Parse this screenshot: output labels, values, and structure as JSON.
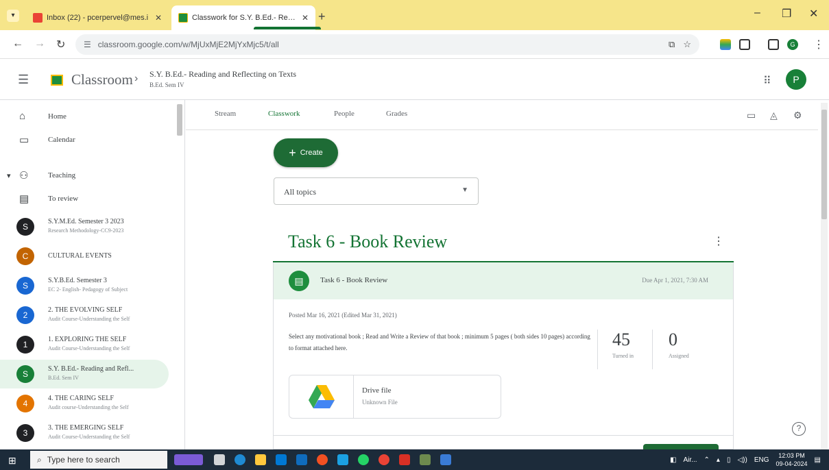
{
  "browser": {
    "tabs": [
      {
        "title": "Inbox (22) - pcerpervel@mes.i",
        "active": false
      },
      {
        "title": "Classwork for S.Y. B.Ed.- Readi",
        "active": true
      }
    ],
    "url": "classroom.google.com/w/MjUxMjE2MjYxMjc5/t/all",
    "profile_initial": "G"
  },
  "header": {
    "brand": "Classroom",
    "course_title": "S.Y. B.Ed.- Reading and Reflecting on Texts",
    "course_section": "B.Ed. Sem IV",
    "avatar_initial": "P"
  },
  "sidebar": {
    "nav": [
      {
        "label": "Home",
        "icon": "home-icon"
      },
      {
        "label": "Calendar",
        "icon": "calendar-icon"
      },
      {
        "label": "Teaching",
        "icon": "people-icon"
      },
      {
        "label": "To review",
        "icon": "folder-icon"
      }
    ],
    "classes": [
      {
        "initial": "S",
        "name": "S.Y.M.Ed. Semester 3 2023",
        "sub": "Research Methodology-CC9-2023",
        "color": "#202124",
        "active": false
      },
      {
        "initial": "C",
        "name": "CULTURAL EVENTS",
        "sub": "",
        "color": "#c26401",
        "active": false
      },
      {
        "initial": "S",
        "name": "S.Y.B.Ed. Semester 3",
        "sub": "EC 2- English- Pedagogy of Subject",
        "color": "#1967d2",
        "active": false
      },
      {
        "initial": "2",
        "name": "2. THE EVOLVING SELF",
        "sub": "Audit Course-Understanding the Self",
        "color": "#1967d2",
        "active": false
      },
      {
        "initial": "1",
        "name": "1. EXPLORING THE SELF",
        "sub": "Audit Course-Understanding the Self",
        "color": "#202124",
        "active": false
      },
      {
        "initial": "S",
        "name": "S.Y. B.Ed.- Reading and Refl...",
        "sub": "B.Ed. Sem IV",
        "color": "#188038",
        "active": true
      },
      {
        "initial": "4",
        "name": "4. THE CARING SELF",
        "sub": "Audit course-Understanding the Self",
        "color": "#e37400",
        "active": false
      },
      {
        "initial": "3",
        "name": "3. THE EMERGING SELF",
        "sub": "Audit Course-Understanding the Self",
        "color": "#202124",
        "active": false
      }
    ]
  },
  "main": {
    "tabs": [
      "Stream",
      "Classwork",
      "People",
      "Grades"
    ],
    "active_tab": "Classwork",
    "create_label": "Create",
    "topic_filter": "All topics",
    "topic": {
      "title": "Task 6 - Book Review",
      "assignment": {
        "title": "Task 6 - Book Review",
        "due": "Due Apr 1, 2021, 7:30 AM",
        "posted": "Posted Mar 16, 2021 (Edited Mar 31, 2021)",
        "description": "Select any motivational book ; Read and Write a Review of that book ; minimum 5 pages ( both sides 10 pages) according to format attached here.",
        "turned_in": "45",
        "turned_in_label": "Turned in",
        "assigned": "0",
        "assigned_label": "Assigned",
        "attachment": {
          "name": "Drive file",
          "type": "Unknown File"
        }
      }
    }
  },
  "taskbar": {
    "search_placeholder": "Type here to search",
    "tray_label": "Air...",
    "lang": "ENG",
    "time": "12:03 PM",
    "date": "09-04-2024"
  },
  "colors": {
    "accent": "#137333",
    "create_button": "#1e6b35",
    "assignment_header": "#e6f4ea"
  }
}
